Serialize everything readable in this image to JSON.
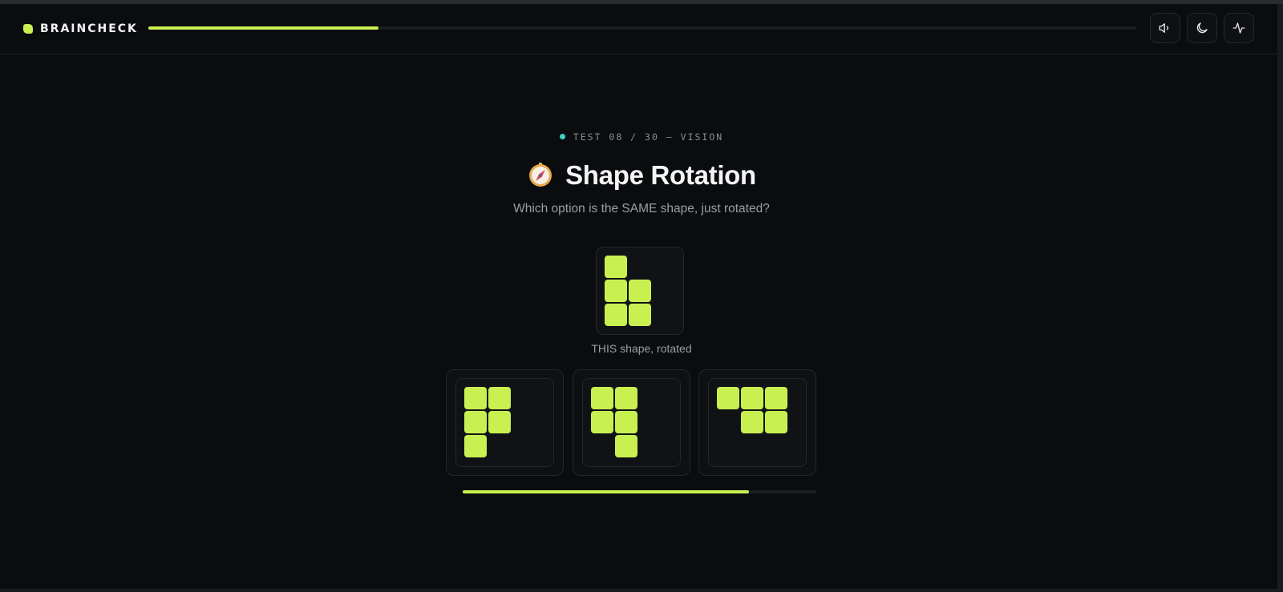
{
  "header": {
    "brand": "BRAINCHECK",
    "overall_progress_fraction": 0.233,
    "buttons": [
      {
        "name": "sound-button",
        "icon": "speaker-icon"
      },
      {
        "name": "theme-button",
        "icon": "moon-icon"
      },
      {
        "name": "stats-button",
        "icon": "activity-icon"
      }
    ]
  },
  "test": {
    "eyebrow": "TEST 08 / 30 — VISION",
    "title": "Shape Rotation",
    "title_icon": "compass-icon",
    "subtitle": "Which option is the SAME shape, just rotated?",
    "target_caption": "THIS shape, rotated",
    "target_shape": [
      [
        0,
        0
      ],
      [
        0,
        1
      ],
      [
        1,
        1
      ],
      [
        0,
        2
      ],
      [
        1,
        2
      ]
    ],
    "options": [
      {
        "name": "option-1",
        "cells": [
          [
            0,
            0
          ],
          [
            1,
            0
          ],
          [
            0,
            1
          ],
          [
            1,
            1
          ],
          [
            0,
            2
          ]
        ]
      },
      {
        "name": "option-2",
        "cells": [
          [
            0,
            0
          ],
          [
            1,
            0
          ],
          [
            0,
            1
          ],
          [
            1,
            1
          ],
          [
            1,
            2
          ]
        ]
      },
      {
        "name": "option-3",
        "cells": [
          [
            0,
            0
          ],
          [
            1,
            0
          ],
          [
            2,
            0
          ],
          [
            1,
            1
          ],
          [
            2,
            1
          ]
        ]
      }
    ],
    "time_remaining_fraction": 0.81
  },
  "colors": {
    "accent": "#c8f051",
    "background": "#0b0c0e",
    "eyebrow_dot": "#3fd3c2"
  }
}
